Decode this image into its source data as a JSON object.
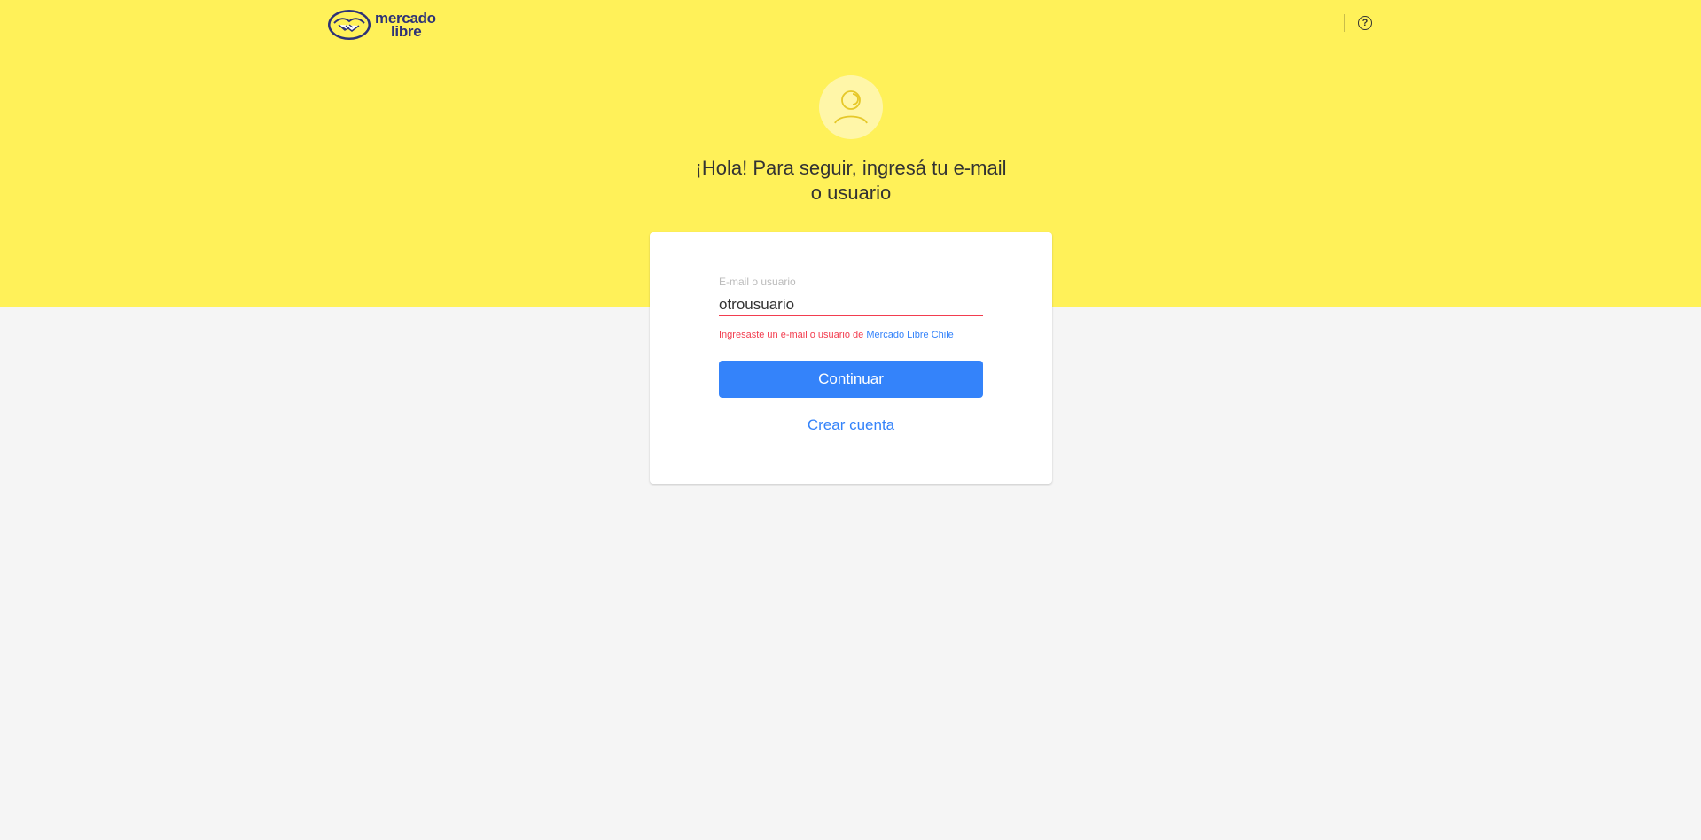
{
  "header": {
    "logo": {
      "line1": "mercado",
      "line2": "libre",
      "icon": "handshake-icon"
    },
    "help_icon": "question-circle-icon",
    "help_symbol": "?"
  },
  "hero": {
    "avatar_icon": "user-icon",
    "heading_line1": "¡Hola! Para seguir, ingresá tu e-mail",
    "heading_line2": "o usuario"
  },
  "form": {
    "label": "E-mail o usuario",
    "value": "otrousuario",
    "error_text": "Ingresaste un e-mail o usuario de ",
    "error_link": "Mercado Libre Chile",
    "continue_label": "Continuar",
    "create_label": "Crear cuenta"
  },
  "colors": {
    "brand_yellow": "#fff159",
    "accent_blue": "#3483fa",
    "error_red": "#f23d4f",
    "background": "#f5f5f5"
  }
}
